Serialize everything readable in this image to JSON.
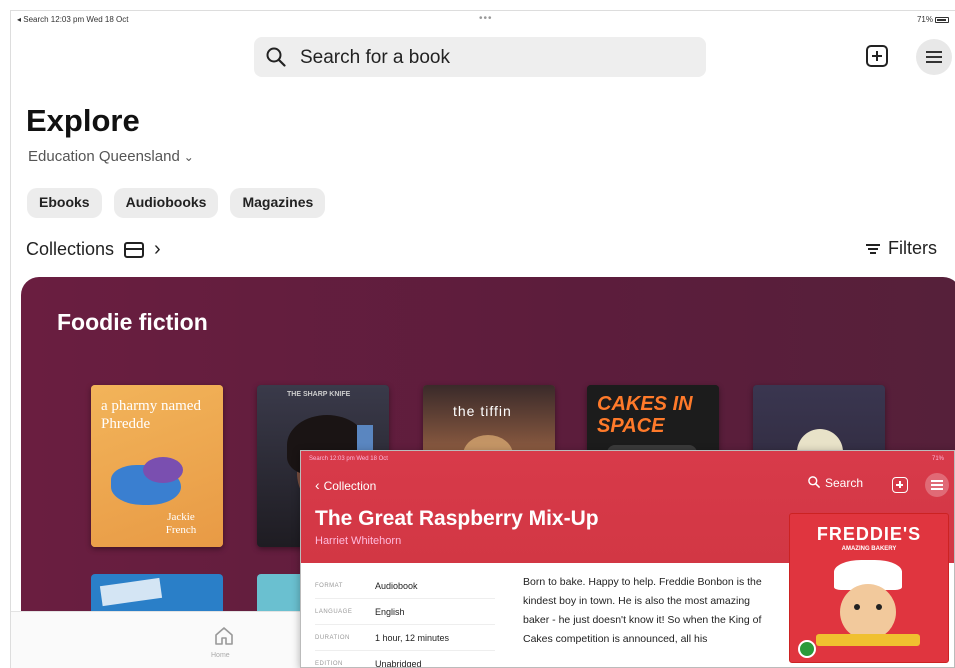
{
  "status_bar": {
    "left": "◂ Search   12:03 pm   Wed 18 Oct",
    "dots": "•••",
    "right": "71%"
  },
  "search": {
    "placeholder": "Search for a book"
  },
  "page": {
    "title": "Explore",
    "organization": "Education Queensland"
  },
  "chips": [
    "Ebooks",
    "Audiobooks",
    "Magazines"
  ],
  "collections_label": "Collections",
  "filters_label": "Filters",
  "carousel": {
    "heading": "Foodie fiction",
    "covers": [
      {
        "title": "a pharmy named Phredde",
        "author": "Jackie French",
        "bg": "#f0a64e"
      },
      {
        "title": "THE SHARP KNIFE",
        "bg": "#2c2a33"
      },
      {
        "title": "the tiffin",
        "bg": "#6b4436"
      },
      {
        "title": "CAKES IN SPACE",
        "bg": "#1c1c1c"
      },
      {
        "title": "",
        "bg": "#2e2a3e"
      }
    ]
  },
  "tab_bar": {
    "home_label": "Home"
  },
  "overlay": {
    "status": "Search   12:03 pm   Wed 18 Oct",
    "status_right": "71%",
    "back_label": "Collection",
    "search_label": "Search",
    "title": "The Great Raspberry Mix-Up",
    "author": "Harriet Whitehorn",
    "cover": {
      "title": "FREDDIE'S",
      "subtitle": "AMAZING BAKERY"
    },
    "meta": [
      {
        "key": "FORMAT",
        "value": "Audiobook"
      },
      {
        "key": "LANGUAGE",
        "value": "English"
      },
      {
        "key": "DURATION",
        "value": "1 hour, 12 minutes"
      },
      {
        "key": "EDITION",
        "value": "Unabridged"
      }
    ],
    "description": "Born to bake. Happy to help. Freddie Bonbon is the kindest boy in town. He is also the most amazing baker - he just doesn't know it! So when the King of Cakes competition is announced, all his"
  },
  "colors": {
    "carousel_bg": "#5f1e3d",
    "overlay_header": "#d6384a",
    "chip_bg": "#ececec"
  }
}
